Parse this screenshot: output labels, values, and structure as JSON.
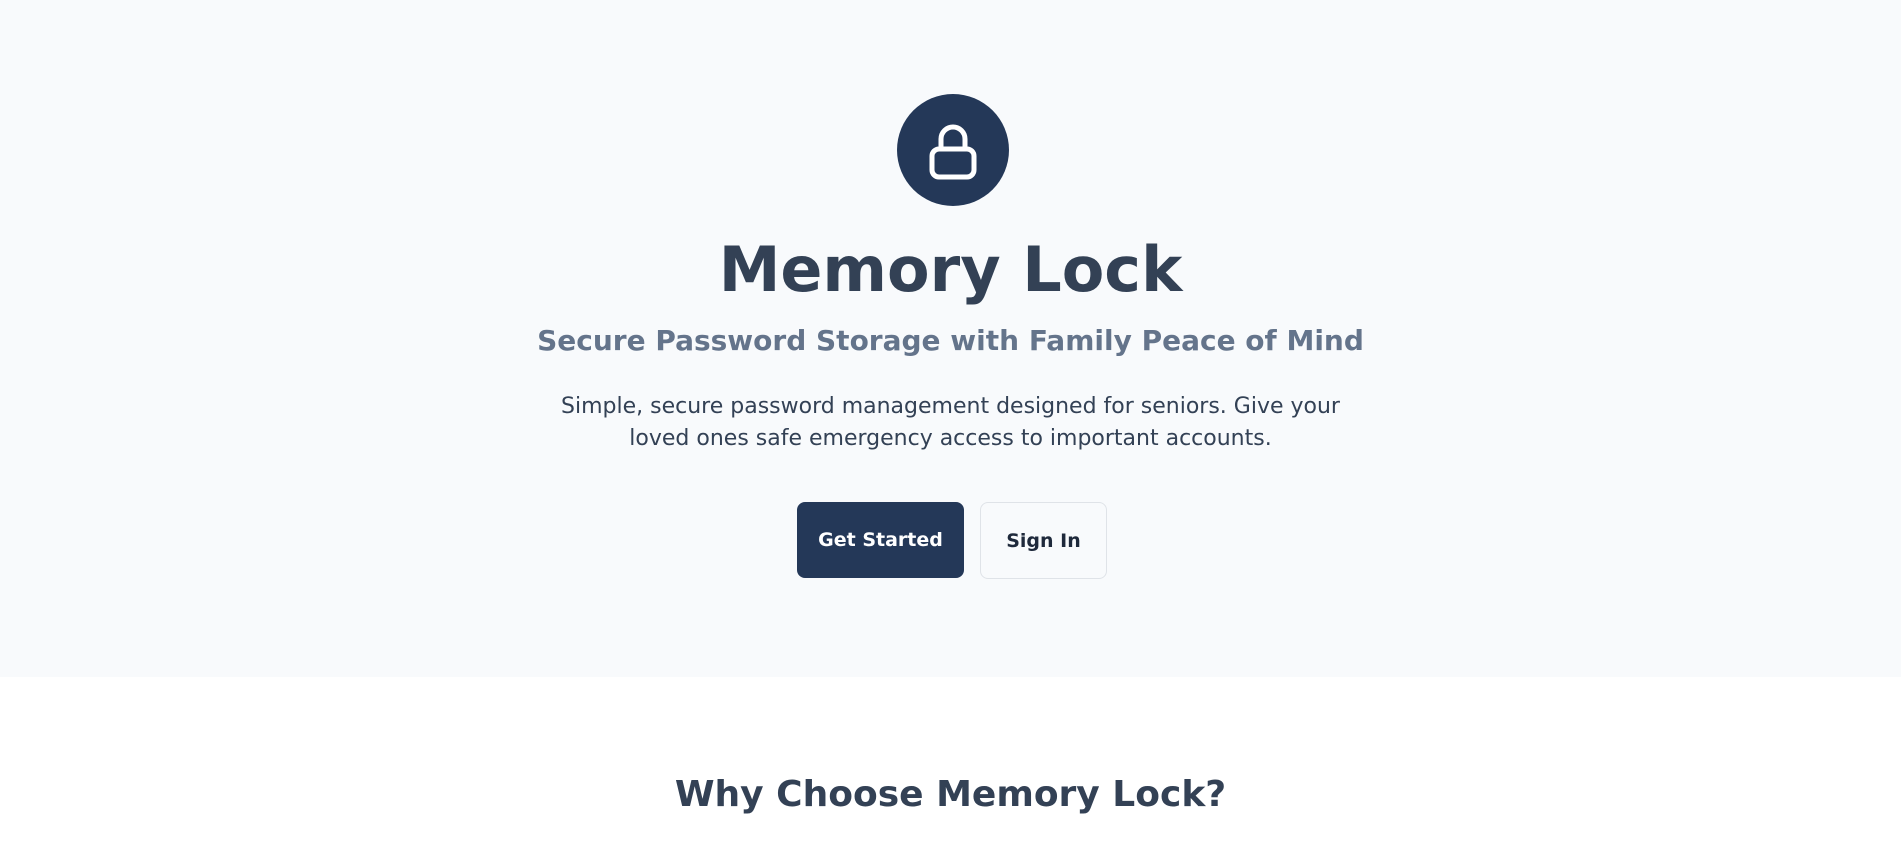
{
  "hero": {
    "logo_icon": "lock-icon",
    "title": "Memory Lock",
    "subtitle": "Secure Password Storage with Family Peace of Mind",
    "description": "Simple, secure password management designed for seniors. Give your loved ones safe emergency access to important accounts.",
    "primary_button": "Get Started",
    "secondary_button": "Sign In"
  },
  "features": {
    "heading": "Why Choose Memory Lock?"
  },
  "colors": {
    "brand": "#243858",
    "hero_background": "#f8fafc",
    "heading_text": "#334155",
    "subtitle_text": "#64748b"
  }
}
